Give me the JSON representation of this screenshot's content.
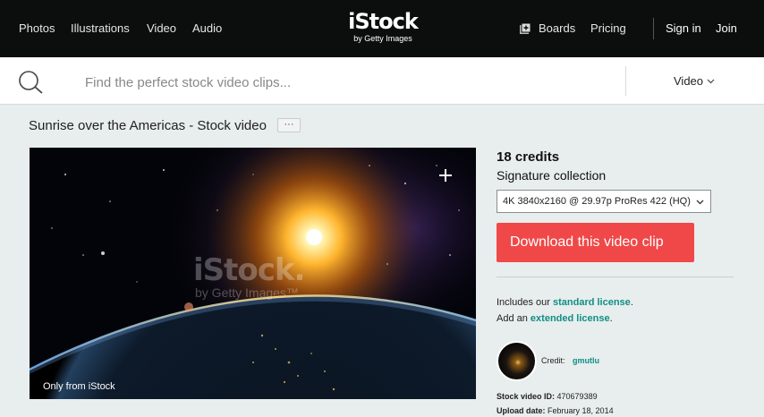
{
  "nav": {
    "left_links": [
      "Photos",
      "Illustrations",
      "Video",
      "Audio"
    ],
    "logo_main": "iStock",
    "logo_sub": "by Getty Images",
    "boards": "Boards",
    "pricing": "Pricing",
    "sign_in": "Sign in",
    "join": "Join"
  },
  "search": {
    "placeholder": "Find the perfect stock video clips...",
    "type_label": "Video"
  },
  "page": {
    "title": "Sunrise over the Americas - Stock video",
    "more_label": "···"
  },
  "video": {
    "watermark_main": "iStock.",
    "watermark_sub": "by Getty Images™",
    "badge": "Only from iStock"
  },
  "panel": {
    "credits": "18 credits",
    "collection": "Signature collection",
    "format": "4K 3840x2160 @ 29.97p ProRes 422 (HQ)",
    "download_label": "Download this video clip",
    "license1_prefix": "Includes our ",
    "license1_link": "standard license",
    "license1_suffix": ".",
    "license2_prefix": "Add an ",
    "license2_link": "extended license",
    "license2_suffix": ".",
    "credit_label": "Credit:",
    "credit_name": "gmutlu",
    "id_label": "Stock video ID:",
    "id_value": "470679389",
    "upload_label": "Upload date:",
    "upload_value": "February 18, 2014"
  },
  "colors": {
    "accent": "#f04848",
    "link": "#0f8f85",
    "topbar": "#0c0d0d"
  }
}
